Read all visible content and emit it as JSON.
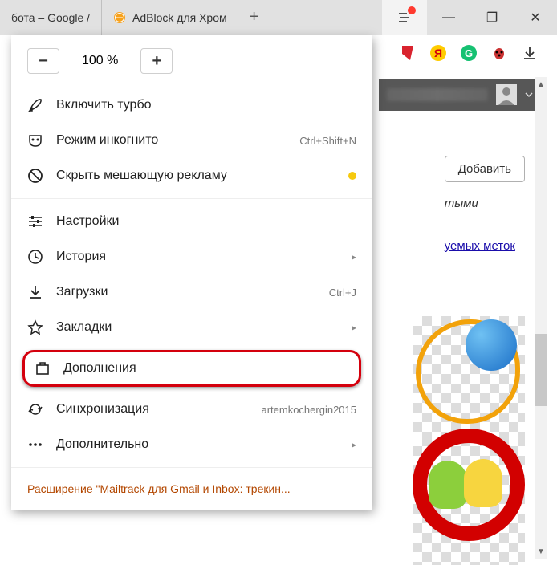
{
  "titlebar": {
    "tab1_label": "бота – Google /",
    "tab2_label": "AdBlock для Хром",
    "newtab_glyph": "+"
  },
  "window_controls": {
    "minimize_glyph": "—",
    "maximize_glyph": "❐",
    "close_glyph": "✕"
  },
  "menu": {
    "zoom": {
      "minus": "−",
      "value": "100 %",
      "plus": "+"
    },
    "turbo": "Включить турбо",
    "incognito": "Режим инкогнито",
    "incognito_shortcut": "Ctrl+Shift+N",
    "hide_ads": "Скрыть мешающую рекламу",
    "settings": "Настройки",
    "history": "История",
    "downloads": "Загрузки",
    "downloads_shortcut": "Ctrl+J",
    "bookmarks": "Закладки",
    "addons": "Дополнения",
    "sync": "Синхронизация",
    "sync_account": "artemkochergin2015",
    "more": "Дополнительно",
    "notification": "Расширение \"Mailtrack для Gmail и Inbox: трекин..."
  },
  "page": {
    "add_button": "Добавить",
    "text1": "тыми",
    "link_fragment": "уемых меток"
  },
  "scroll": {
    "up": "▲",
    "down": "▼"
  },
  "submenu_arrow": "▸"
}
